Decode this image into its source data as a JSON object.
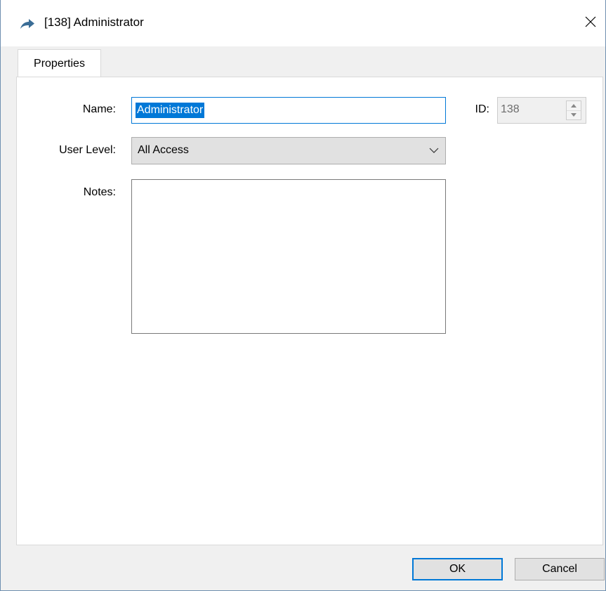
{
  "window": {
    "title": "[138] Administrator",
    "title_icon": "arrow-icon",
    "close_icon": "close-icon",
    "close_glyph": "✕"
  },
  "tabs": [
    {
      "label": "Properties",
      "selected": true
    }
  ],
  "form": {
    "name_label": "Name:",
    "name_value": "Administrator",
    "id_label": "ID:",
    "id_value": "138",
    "user_level_label": "User Level:",
    "user_level_value": "All Access",
    "notes_label": "Notes:",
    "notes_value": ""
  },
  "buttons": {
    "ok_label": "OK",
    "cancel_label": "Cancel"
  },
  "colors": {
    "accent": "#0078d7",
    "selection_text": "#ffffff"
  }
}
